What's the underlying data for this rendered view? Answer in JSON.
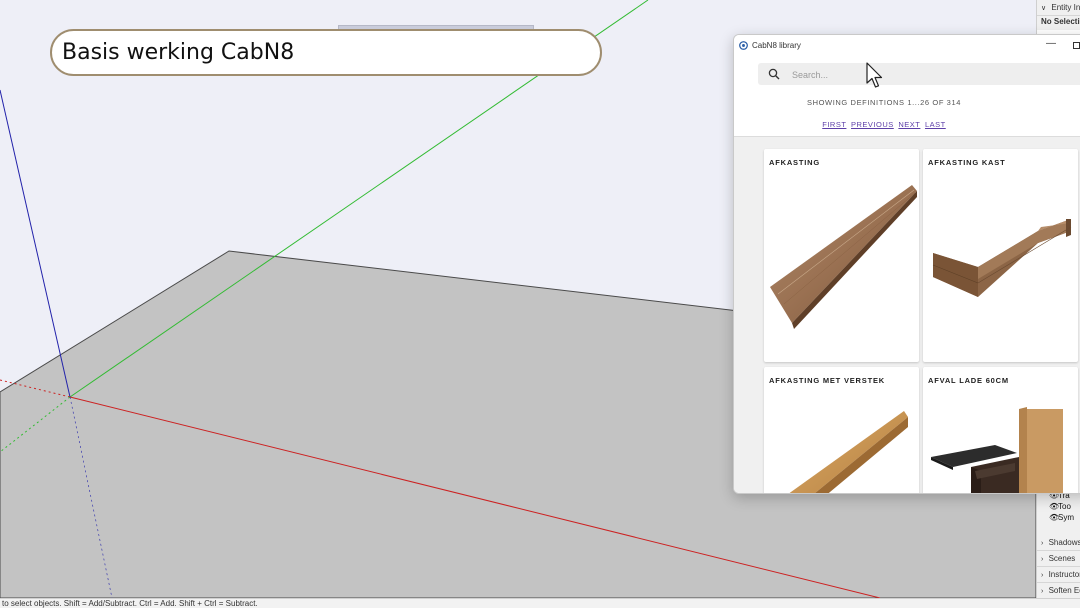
{
  "overlay_title": "Basis werking CabN8",
  "statusbar": {
    "text": "to select objects. Shift = Add/Subtract. Ctrl = Add. Shift + Ctrl = Subtract."
  },
  "tray": {
    "header": "Entity Info",
    "no_selection": "No Selection",
    "eye_items": [
      "Tra",
      "Too",
      "Sym"
    ],
    "panels": [
      "Shadows",
      "Scenes",
      "Instructor",
      "Soften Edges"
    ]
  },
  "library": {
    "window_title": "CabN8 library",
    "search_placeholder": "Search...",
    "showing_text": "SHOWING DEFINITIONS 1...26 OF 314",
    "pager": {
      "first": "FIRST",
      "previous": "PREVIOUS",
      "next": "NEXT",
      "last": "LAST"
    },
    "items": [
      {
        "title": "AFKASTING",
        "icon": "wood-plank-image"
      },
      {
        "title": "AFKASTING KAST",
        "icon": "wood-frame-image"
      },
      {
        "title": "AFKASTING MET VERSTEK",
        "icon": "oak-plank-image"
      },
      {
        "title": "AFVAL LADE 60CM",
        "icon": "waste-drawer-image"
      }
    ]
  },
  "colors": {
    "title_border": "#9f8d6f",
    "link": "#5d3fa8",
    "ground": "#c3c3c3",
    "axis_red": "#cc2222",
    "axis_green": "#33bb33",
    "axis_blue": "#2222aa"
  }
}
